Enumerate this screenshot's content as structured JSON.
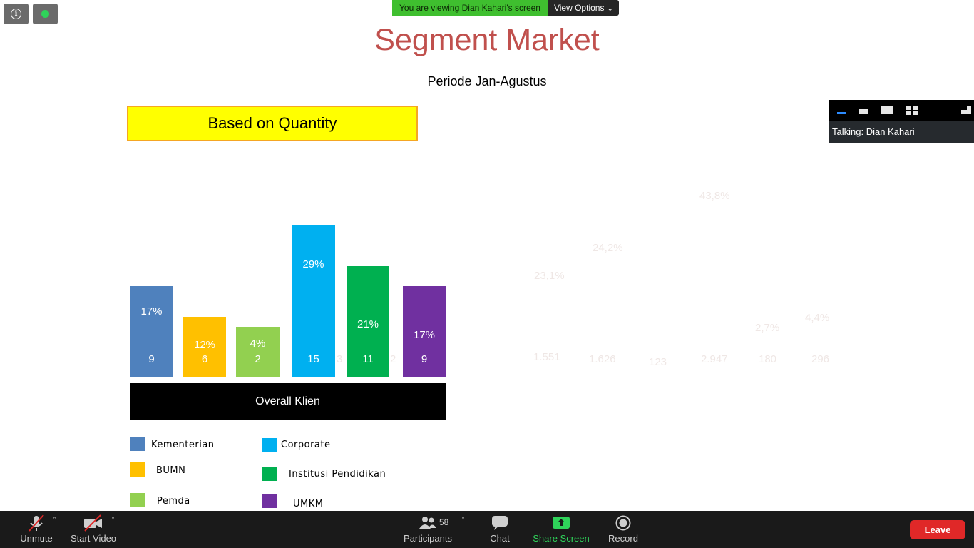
{
  "banner": {
    "viewing_text": "You are viewing Dian Kahari's screen",
    "view_options_label": "View Options"
  },
  "slide": {
    "title": "Segment Market",
    "subtitle": "Periode Jan-Agustus",
    "quantity_box": "Based on Quantity",
    "overall_label": "Overall Klien",
    "legend": [
      {
        "label": "Kementerian",
        "color": "#4f81bd"
      },
      {
        "label": "BUMN",
        "color": "#ffc000"
      },
      {
        "label": "Pemda",
        "color": "#92d050"
      },
      {
        "label": "Corporate",
        "color": "#00b0f0"
      },
      {
        "label": "Institusi Pendidikan",
        "color": "#00b050"
      },
      {
        "label": "UMKM",
        "color": "#7030a0"
      }
    ],
    "ghost_values": [
      "43,8%",
      "24,2%",
      "23,1%",
      "2,7%",
      "4,4%",
      "1.551",
      "1.626",
      "123",
      "2.947",
      "180",
      "296"
    ],
    "ghost_fragments": [
      "3",
      "2"
    ]
  },
  "chart_data": {
    "type": "bar",
    "categories": [
      "Kementerian",
      "BUMN",
      "Pemda",
      "Corporate",
      "Institusi Pendidikan",
      "UMKM"
    ],
    "values": [
      9,
      6,
      2,
      15,
      11,
      9
    ],
    "percent_labels": [
      "17%",
      "12%",
      "4%",
      "29%",
      "21%",
      "17%"
    ],
    "colors": [
      "#4f81bd",
      "#ffc000",
      "#92d050",
      "#00b0f0",
      "#00b050",
      "#7030a0"
    ],
    "value_labels": [
      "9",
      "6",
      "2",
      "15",
      "11",
      "9"
    ],
    "title": "",
    "xlabel": "",
    "ylabel": ""
  },
  "layout_panel": {
    "talking_text": "Talking: Dian Kahari"
  },
  "toolbar": {
    "unmute": "Unmute",
    "start_video": "Start Video",
    "participants": "Participants",
    "participants_count": "58",
    "chat": "Chat",
    "share_screen": "Share Screen",
    "record": "Record",
    "leave": "Leave"
  },
  "colors": {
    "share_green": "#2fd35a",
    "leave_red": "#e02828",
    "title_red": "#c0504d"
  }
}
